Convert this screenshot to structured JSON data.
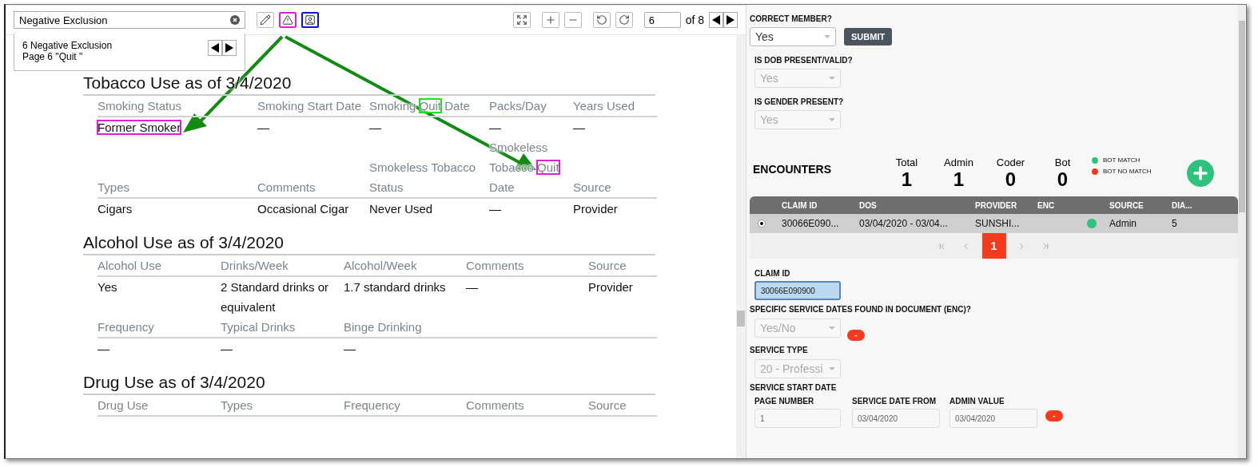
{
  "viewer": {
    "search": {
      "value": "Negative Exclusion"
    },
    "search_result": {
      "title": "6 Negative Exclusion",
      "detail": "Page 6 \"Quit \""
    },
    "annotation_tools": [
      {
        "kind": "pen"
      },
      {
        "kind": "warning",
        "color": "#e020d8"
      },
      {
        "kind": "person",
        "color": "#1010e0"
      }
    ],
    "view_tools": [
      {
        "kind": "fit"
      },
      {
        "kind": "zoom_in"
      },
      {
        "kind": "zoom_out"
      },
      {
        "kind": "rotate_left"
      },
      {
        "kind": "rotate_right"
      }
    ],
    "page": "6",
    "page_count": "of 8"
  },
  "document": {
    "sections": [
      {
        "title": "Tobacco Use as of 3/4/2020",
        "rows": [
          {
            "kind": "header",
            "cells": [
              "Smoking Status",
              "Smoking Start Date",
              [
                {
                  "text": "Smoking "
                },
                {
                  "text": "Quit",
                  "color": "#22dd22"
                },
                {
                  "text": " Date"
                }
              ],
              "Packs/Day",
              "Years Used"
            ]
          },
          {
            "kind": "value",
            "cells": [
              [
                {
                  "text": "Former Smoker",
                  "color": "#e020d8"
                }
              ],
              "—",
              "—",
              "—",
              "—"
            ]
          },
          {
            "kind": "header",
            "cells": [
              "Types",
              "Comments",
              "Smokeless Tobacco Status",
              [
                {
                  "text": "Smokeless Tobacco "
                },
                {
                  "text": "Quit",
                  "color": "#e020d8"
                },
                {
                  "text": " Date"
                }
              ],
              "Source"
            ]
          },
          {
            "kind": "value",
            "cells": [
              "Cigars",
              "Occasional Cigar",
              "Never Used",
              "—",
              "Provider"
            ]
          }
        ]
      },
      {
        "title": "Alcohol Use as of 3/4/2020",
        "rows": [
          {
            "kind": "header",
            "cells": [
              "Alcohol Use",
              "Drinks/Week",
              "Alcohol/Week",
              "Comments",
              "Source"
            ]
          },
          {
            "kind": "value",
            "cells": [
              "Yes",
              "2 Standard drinks or equivalent",
              "1.7 standard drinks",
              "—",
              "Provider"
            ]
          },
          {
            "kind": "header",
            "cells": [
              "Frequency",
              "Typical Drinks",
              "Binge Drinking",
              "",
              ""
            ]
          },
          {
            "kind": "value",
            "cells": [
              "—",
              "—",
              "—",
              "",
              ""
            ]
          }
        ]
      },
      {
        "title": "Drug Use as of 3/4/2020",
        "rows": [
          {
            "kind": "header",
            "cells": [
              "Drug Use",
              "Types",
              "Frequency",
              "Comments",
              "Source"
            ]
          }
        ]
      }
    ]
  },
  "member_form": {
    "fields": [
      {
        "label": "CORRECT MEMBER?",
        "value": "Yes",
        "disabled": false
      },
      {
        "label": "IS DOB PRESENT/VALID?",
        "value": "Yes",
        "disabled": true
      },
      {
        "label": "IS GENDER PRESENT?",
        "value": "Yes",
        "disabled": true
      }
    ],
    "submit": "SUBMIT"
  },
  "encounters": {
    "title": "ENCOUNTERS",
    "stats": [
      {
        "label": "Total",
        "value": "1"
      },
      {
        "label": "Admin",
        "value": "1"
      },
      {
        "label": "Coder",
        "value": "0"
      },
      {
        "label": "Bot",
        "value": "0"
      }
    ],
    "legend": [
      {
        "label": "BOT MATCH",
        "color": "#2ec27e"
      },
      {
        "label": "BOT NO MATCH",
        "color": "#f53b1f"
      }
    ],
    "columns": [
      "CLAIM ID",
      "DOS",
      "PROVIDER",
      "ENC",
      "SOURCE",
      "DIA..."
    ],
    "rows": [
      {
        "selected": true,
        "claim_id": "30066E090...",
        "dos": "03/04/2020 - 03/04...",
        "provider": "SUNSHI...",
        "color": "#2ec27e",
        "source": "Admin",
        "dia": "5"
      }
    ],
    "pages": [
      {
        "label": "1",
        "selected": true
      }
    ]
  },
  "claim_form": {
    "claim_id": {
      "label": "CLAIM ID",
      "value": "30066E090900"
    },
    "service_dates": {
      "label": "SPECIFIC SERVICE DATES FOUND IN DOCUMENT (ENC)?",
      "placeholder": "Yes/No",
      "remove": "-"
    },
    "service_type": {
      "label": "SERVICE TYPE",
      "value": "20 - Professi"
    },
    "start_date": {
      "title": "SERVICE START DATE",
      "fields": [
        {
          "label": "PAGE NUMBER",
          "value": "1"
        },
        {
          "label": "SERVICE DATE FROM",
          "value": "03/04/2020"
        },
        {
          "label": "ADMIN VALUE",
          "value": "03/04/2020"
        }
      ],
      "remove": "-"
    }
  }
}
